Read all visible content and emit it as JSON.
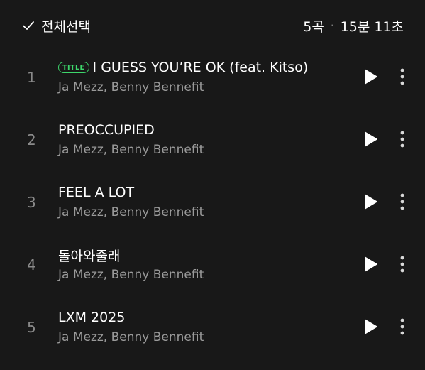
{
  "header": {
    "select_all_label": "전체선택",
    "track_count": "5곡",
    "separator": "·",
    "total_duration": "15분 11초"
  },
  "badge": {
    "title_label": "TITLE",
    "color": "#3dd66b"
  },
  "colors": {
    "background": "#181818",
    "primary_text": "#ffffff",
    "secondary_text": "#9a9a9a",
    "accent": "#3dd66b"
  },
  "tracks": [
    {
      "number": "1",
      "title": "I GUESS YOU’RE OK (feat. Kitso)",
      "artist": "Ja Mezz, Benny Bennefit",
      "is_title_track": true
    },
    {
      "number": "2",
      "title": "PREOCCUPIED",
      "artist": "Ja Mezz, Benny Bennefit",
      "is_title_track": false
    },
    {
      "number": "3",
      "title": "FEEL A LOT",
      "artist": "Ja Mezz, Benny Bennefit",
      "is_title_track": false
    },
    {
      "number": "4",
      "title": "돌아와줄래",
      "artist": "Ja Mezz, Benny Bennefit",
      "is_title_track": false
    },
    {
      "number": "5",
      "title": "LXM 2025",
      "artist": "Ja Mezz, Benny Bennefit",
      "is_title_track": false
    }
  ],
  "icons": {
    "select_all": "checkmark-icon",
    "play": "play-icon",
    "more": "more-vertical-icon"
  }
}
